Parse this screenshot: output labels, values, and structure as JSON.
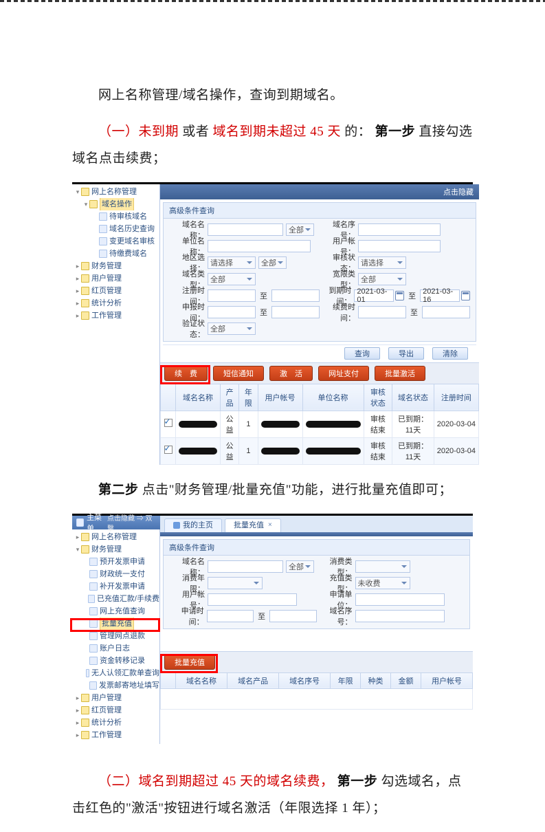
{
  "text": {
    "p1_a": "网上名称管理/域名操作，查询到期域名。",
    "p2_r1": "（一）未到期",
    "p2_b1": "或者",
    "p2_r2": "域名到期未超过 45 天",
    "p2_b2": "的：",
    "p2_bold": "第一步",
    "p2_b3": "直接勾选域名点击续费；",
    "p3_bold": "第二步",
    "p3_a": "点击\"财务管理/批量充值\"功能，进行批量充值即可；",
    "p4_r1": "（二）域名到期超过 45 天的域名续费，",
    "p4_bold": "第一步",
    "p4_a": "勾选域名，点击红色的\"激活\"按钮进行域名激活（年限选择 1 年）；"
  },
  "shot1": {
    "tree": [
      {
        "depth": 0,
        "label": "网上名称管理",
        "folder": true,
        "expand": "▾"
      },
      {
        "depth": 1,
        "label": "域名操作",
        "folder": true,
        "expand": "▾",
        "sel": true
      },
      {
        "depth": 2,
        "label": "待审核域名",
        "leaf": true
      },
      {
        "depth": 2,
        "label": "域名历史查询",
        "leaf": true
      },
      {
        "depth": 2,
        "label": "变更域名审核",
        "leaf": true
      },
      {
        "depth": 2,
        "label": "待缴费域名",
        "leaf": true
      },
      {
        "depth": 0,
        "label": "财务管理",
        "folder": true,
        "expand": "▸"
      },
      {
        "depth": 0,
        "label": "用户管理",
        "folder": true,
        "expand": "▸"
      },
      {
        "depth": 0,
        "label": "红页管理",
        "folder": true,
        "expand": "▸"
      },
      {
        "depth": 0,
        "label": "统计分析",
        "folder": true,
        "expand": "▸"
      },
      {
        "depth": 0,
        "label": "工作管理",
        "folder": true,
        "expand": "▸"
      }
    ],
    "darkbar_right": "点击隐藏",
    "filter_caption": "高级条件查询",
    "labels": {
      "domain": "域名名称：",
      "unit": "单位名称：",
      "region": "地区选择：",
      "dtype": "域名类型：",
      "regtime": "注册时间：",
      "apptime": "申报时间：",
      "vstate": "验证状态：",
      "seq": "域名序号：",
      "uacct": "用户帐号：",
      "astate": "审核状态：",
      "ltype": "宽限类型：",
      "exp": "到期时间：",
      "renew": "续费时间："
    },
    "vals": {
      "quanbu": "全部",
      "qingxuan": "请选择",
      "date1": "2021-03-01",
      "date2": "2021-03-16",
      "zhi": "至"
    },
    "btns": {
      "search": "查询",
      "export": "导出",
      "clear": "清除"
    },
    "pills": [
      "续　费",
      "短信通知",
      "激　活",
      "网址支付",
      "批量激活"
    ],
    "thead": [
      "",
      "域名名称",
      "产品",
      "年限",
      "用户帐号",
      "单位名称",
      "审核状态",
      "域名状态",
      "注册时间"
    ],
    "rows": [
      {
        "chk": true,
        "prod": "公益",
        "yr": "1",
        "audit": "审核结束",
        "dstat": "已到期：11天",
        "reg": "2020-03-04"
      },
      {
        "chk": true,
        "prod": "公益",
        "yr": "1",
        "audit": "审核结束",
        "dstat": "已到期：11天",
        "reg": "2020-03-04"
      }
    ]
  },
  "shot2": {
    "titlebar": "主菜单",
    "hide": "点击隐藏 ⇒ 双 撃",
    "tree": [
      {
        "depth": 0,
        "label": "网上名称管理",
        "folder": true,
        "expand": "▸"
      },
      {
        "depth": 0,
        "label": "财务管理",
        "folder": true,
        "expand": "▾"
      },
      {
        "depth": 1,
        "label": "预开发票申请",
        "leaf": true
      },
      {
        "depth": 1,
        "label": "财政统一支付",
        "leaf": true
      },
      {
        "depth": 1,
        "label": "补开发票申请",
        "leaf": true
      },
      {
        "depth": 1,
        "label": "已充值汇款/手续费",
        "leaf": true
      },
      {
        "depth": 1,
        "label": "网上充值查询",
        "leaf": true
      },
      {
        "depth": 1,
        "label": "批量充值",
        "leaf": true,
        "sel": true
      },
      {
        "depth": 1,
        "label": "管理网点退款",
        "leaf": true
      },
      {
        "depth": 1,
        "label": "账户日志",
        "leaf": true
      },
      {
        "depth": 1,
        "label": "资金转移记录",
        "leaf": true
      },
      {
        "depth": 1,
        "label": "无人认领汇款单查询",
        "leaf": true
      },
      {
        "depth": 1,
        "label": "发票邮寄地址填写",
        "leaf": true
      },
      {
        "depth": 0,
        "label": "用户管理",
        "folder": true,
        "expand": "▸"
      },
      {
        "depth": 0,
        "label": "红页管理",
        "folder": true,
        "expand": "▸"
      },
      {
        "depth": 0,
        "label": "统计分析",
        "folder": true,
        "expand": "▸"
      },
      {
        "depth": 0,
        "label": "工作管理",
        "folder": true,
        "expand": "▸"
      }
    ],
    "tabs": [
      {
        "label": "我的主页",
        "active": false,
        "icon": "home"
      },
      {
        "label": "批量充值",
        "active": true
      }
    ],
    "filter_caption": "高级条件查询",
    "labels": {
      "domain": "域名名称：",
      "consume_y": "消费年限：",
      "uacct": "用户帐号：",
      "apptime": "申请时间：",
      "consume_t": "消费类型：",
      "charge_t": "充值类型：",
      "org": "申请单位：",
      "seq": "域名序号："
    },
    "vals": {
      "quanbu": "全部",
      "weishou": "未收费",
      "zhi": "至"
    },
    "pill": "批量充值",
    "thead": [
      "",
      "域名名称",
      "域名产品",
      "域名序号",
      "年限",
      "种类",
      "金额",
      "用户帐号"
    ]
  }
}
